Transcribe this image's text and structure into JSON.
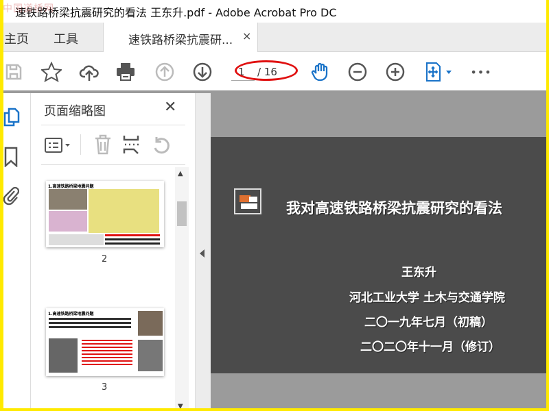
{
  "window": {
    "title": "速铁路桥梁抗震研究的看法 王东升.pdf - Adobe Acrobat Pro DC",
    "watermark": "中国道桥网"
  },
  "tabs": [
    {
      "label": "主页"
    },
    {
      "label": "工具"
    },
    {
      "label": "速铁路桥梁抗震研...",
      "active": true,
      "close": "×"
    }
  ],
  "toolbar": {
    "icons": [
      "save-icon",
      "star-icon",
      "cloud-upload-icon",
      "print-icon",
      "page-up-icon",
      "page-down-icon",
      "hand-icon",
      "zoom-out-icon",
      "zoom-in-icon",
      "fit-page-icon",
      "more-icon"
    ],
    "current_page": "1",
    "total_pages": "/ 16",
    "more": "•••"
  },
  "panel": {
    "title": "页面缩略图",
    "close": "✕",
    "thumbnails": [
      {
        "heading": "1.高速铁路桥梁地震问题",
        "page": "2"
      },
      {
        "heading": "1.高速铁路桥梁地震问题",
        "page": "3"
      }
    ]
  },
  "slide": {
    "title": "我对高速铁路桥梁抗震研究的看法",
    "author": "王东升",
    "affiliation": "河北工业大学 土木与交通学院",
    "date1": "二〇一九年七月（初稿）",
    "date2": "二〇二〇年十一月（修订）"
  },
  "colors": {
    "accent": "#1a73c8",
    "highlight": "#e01010",
    "slide_bg": "#4b4b4b",
    "frame": "#ffea00"
  }
}
